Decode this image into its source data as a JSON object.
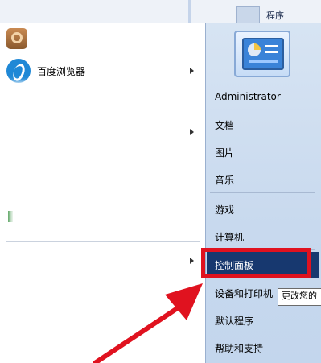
{
  "taskbar_top": {
    "programs_label": "程序"
  },
  "left_menu": {
    "items": [
      {
        "label": "百度浏览器",
        "has_submenu": true,
        "icon": "baidu-browser-icon"
      }
    ]
  },
  "right_menu": {
    "items": [
      {
        "id": "administrator",
        "label": "Administrator"
      },
      {
        "id": "documents",
        "label": "文档"
      },
      {
        "id": "pictures",
        "label": "图片"
      },
      {
        "id": "music",
        "label": "音乐"
      },
      {
        "id": "games",
        "label": "游戏"
      },
      {
        "id": "computer",
        "label": "计算机"
      },
      {
        "id": "control-panel",
        "label": "控制面板",
        "highlighted": true
      },
      {
        "id": "devices-printers",
        "label": "设备和打印机"
      },
      {
        "id": "default-programs",
        "label": "默认程序"
      },
      {
        "id": "help-support",
        "label": "帮助和支持"
      }
    ]
  },
  "tooltip": {
    "text": "更改您的"
  },
  "colors": {
    "highlight": "#17386f",
    "red_annotation": "#e0121f",
    "right_pane": "#c8d9ee"
  }
}
